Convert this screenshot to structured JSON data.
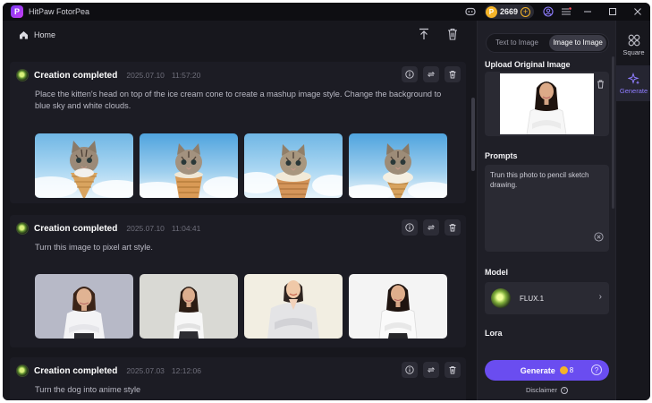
{
  "app": {
    "name": "HitPaw FotorPea",
    "logo_letter": "P"
  },
  "titlebar": {
    "coins": "2669",
    "coin_symbol": "P",
    "coin_plus": "+"
  },
  "toolbar": {
    "home_label": "Home"
  },
  "feed": [
    {
      "title": "Creation completed",
      "date": "2025.07.10",
      "time": "11:57:20",
      "prompt": "Place the kitten's head on top of the ice cream cone to create a mashup image style. Change the background to blue sky and white clouds.",
      "thumb_kind": "kitten"
    },
    {
      "title": "Creation completed",
      "date": "2025.07.10",
      "time": "11:04:41",
      "prompt": "Turn this image to pixel art style.",
      "thumb_kind": "person"
    },
    {
      "title": "Creation completed",
      "date": "2025.07.03",
      "time": "12:12:06",
      "prompt": "Turn the dog into anime style",
      "thumb_kind": "none"
    }
  ],
  "panel": {
    "modes": [
      "Text to Image",
      "Image to Image"
    ],
    "active_mode": "Image to Image",
    "upload_label": "Upload Original Image",
    "prompts_label": "Prompts",
    "prompt_value": "Trun this photo to pencil sketch drawing.",
    "model_label": "Model",
    "model_name": "FLUX.1",
    "lora_label": "Lora",
    "generate_label": "Generate",
    "generate_cost": "8",
    "disclaimer": "Disclaimer"
  },
  "rail": [
    {
      "label": "Square",
      "icon": "grid-icon"
    },
    {
      "label": "Generate",
      "icon": "sparkle-icon"
    }
  ],
  "colors": {
    "accent": "#6a4df0",
    "coin": "#f5b428",
    "background": "#16161c"
  }
}
